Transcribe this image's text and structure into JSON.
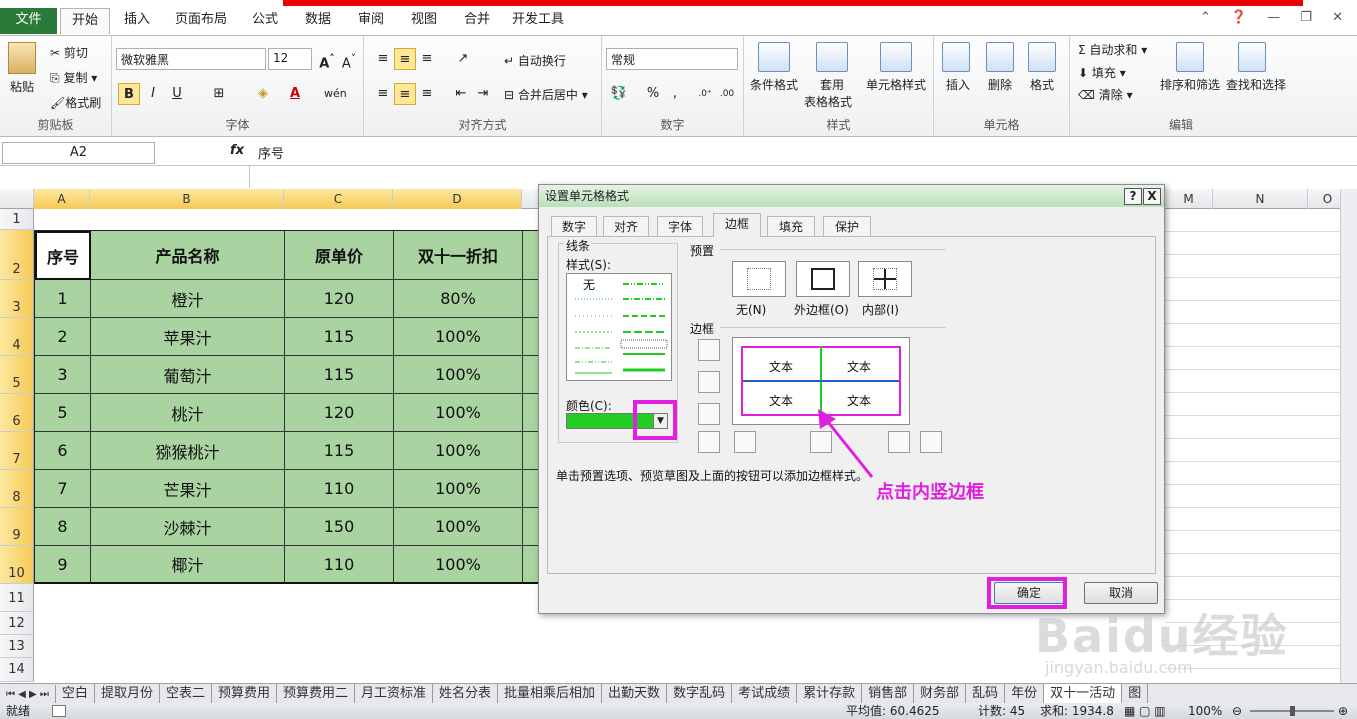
{
  "tabs": [
    "文件",
    "开始",
    "插入",
    "页面布局",
    "公式",
    "数据",
    "审阅",
    "视图",
    "合并",
    "开发工具"
  ],
  "ribbon": {
    "clipboard": {
      "paste": "粘贴",
      "cut": "剪切",
      "copy": "复制",
      "painter": "格式刷",
      "label": "剪贴板"
    },
    "font": {
      "name": "微软雅黑",
      "size": "12",
      "label": "字体",
      "bold": "B",
      "italic": "I",
      "underline": "U"
    },
    "align": {
      "wrap": "自动换行",
      "merge": "合并后居中",
      "label": "对齐方式"
    },
    "number": {
      "format": "常规",
      "label": "数字",
      "percent": "%",
      "comma": ","
    },
    "styles": {
      "cond": "条件格式",
      "table1": "套用",
      "table2": "表格格式",
      "cell": "单元格样式",
      "label": "样式"
    },
    "cells": {
      "insert": "插入",
      "delete": "删除",
      "format": "格式",
      "label": "单元格"
    },
    "edit": {
      "autosum": "自动求和",
      "fill": "填充",
      "clear": "清除",
      "sort": "排序和筛选",
      "find": "查找和选择",
      "label": "编辑"
    }
  },
  "formula": {
    "namebox": "A2",
    "fx": "fx",
    "content": "序号"
  },
  "columns": [
    "A",
    "B",
    "C",
    "D",
    "M",
    "N",
    "O"
  ],
  "rows": [
    "1",
    "2",
    "3",
    "4",
    "5",
    "6",
    "7",
    "8",
    "9",
    "10",
    "11",
    "12",
    "13",
    "14"
  ],
  "table": {
    "headers": [
      "序号",
      "产品名称",
      "原单价",
      "双十一折扣"
    ],
    "rows": [
      [
        "1",
        "橙汁",
        "120",
        "80%"
      ],
      [
        "2",
        "苹果汁",
        "115",
        "100%"
      ],
      [
        "3",
        "葡萄汁",
        "115",
        "100%"
      ],
      [
        "5",
        "桃汁",
        "120",
        "100%"
      ],
      [
        "6",
        "猕猴桃汁",
        "115",
        "100%"
      ],
      [
        "7",
        "芒果汁",
        "110",
        "100%"
      ],
      [
        "8",
        "沙棘汁",
        "150",
        "100%"
      ],
      [
        "9",
        "椰汁",
        "110",
        "100%"
      ]
    ]
  },
  "dialog": {
    "title": "设置单元格格式",
    "help": "?",
    "close": "X",
    "tabs": [
      "数字",
      "对齐",
      "字体",
      "边框",
      "填充",
      "保护"
    ],
    "line_group": "线条",
    "style_label": "样式(S):",
    "none": "无",
    "color_label": "颜色(C):",
    "preset_group": "预置",
    "presets": [
      "无(N)",
      "外边框(O)",
      "内部(I)"
    ],
    "border_group": "边框",
    "preview_text": "文本",
    "hint": "单击预置选项、预览草图及上面的按钮可以添加边框样式。",
    "annotation": "点击内竖边框",
    "ok": "确定",
    "cancel": "取消",
    "line_color": "#22cc22",
    "accent": "#e020e0"
  },
  "sheet_tabs": [
    "空白",
    "提取月份",
    "空表二",
    "预算费用",
    "预算费用二",
    "月工资标准",
    "姓名分表",
    "批量相乘后相加",
    "出勤天数",
    "数字乱码",
    "考试成绩",
    "累计存款",
    "销售部",
    "财务部",
    "乱码",
    "年份",
    "双十一活动",
    "图"
  ],
  "status": {
    "ready": "就绪",
    "avg": "平均值: 60.4625",
    "count": "计数: 45",
    "sum": "求和: 1934.8",
    "zoom": "100%"
  },
  "watermark": {
    "main": "Baidu经验",
    "sub": "jingyan.baidu.com"
  }
}
